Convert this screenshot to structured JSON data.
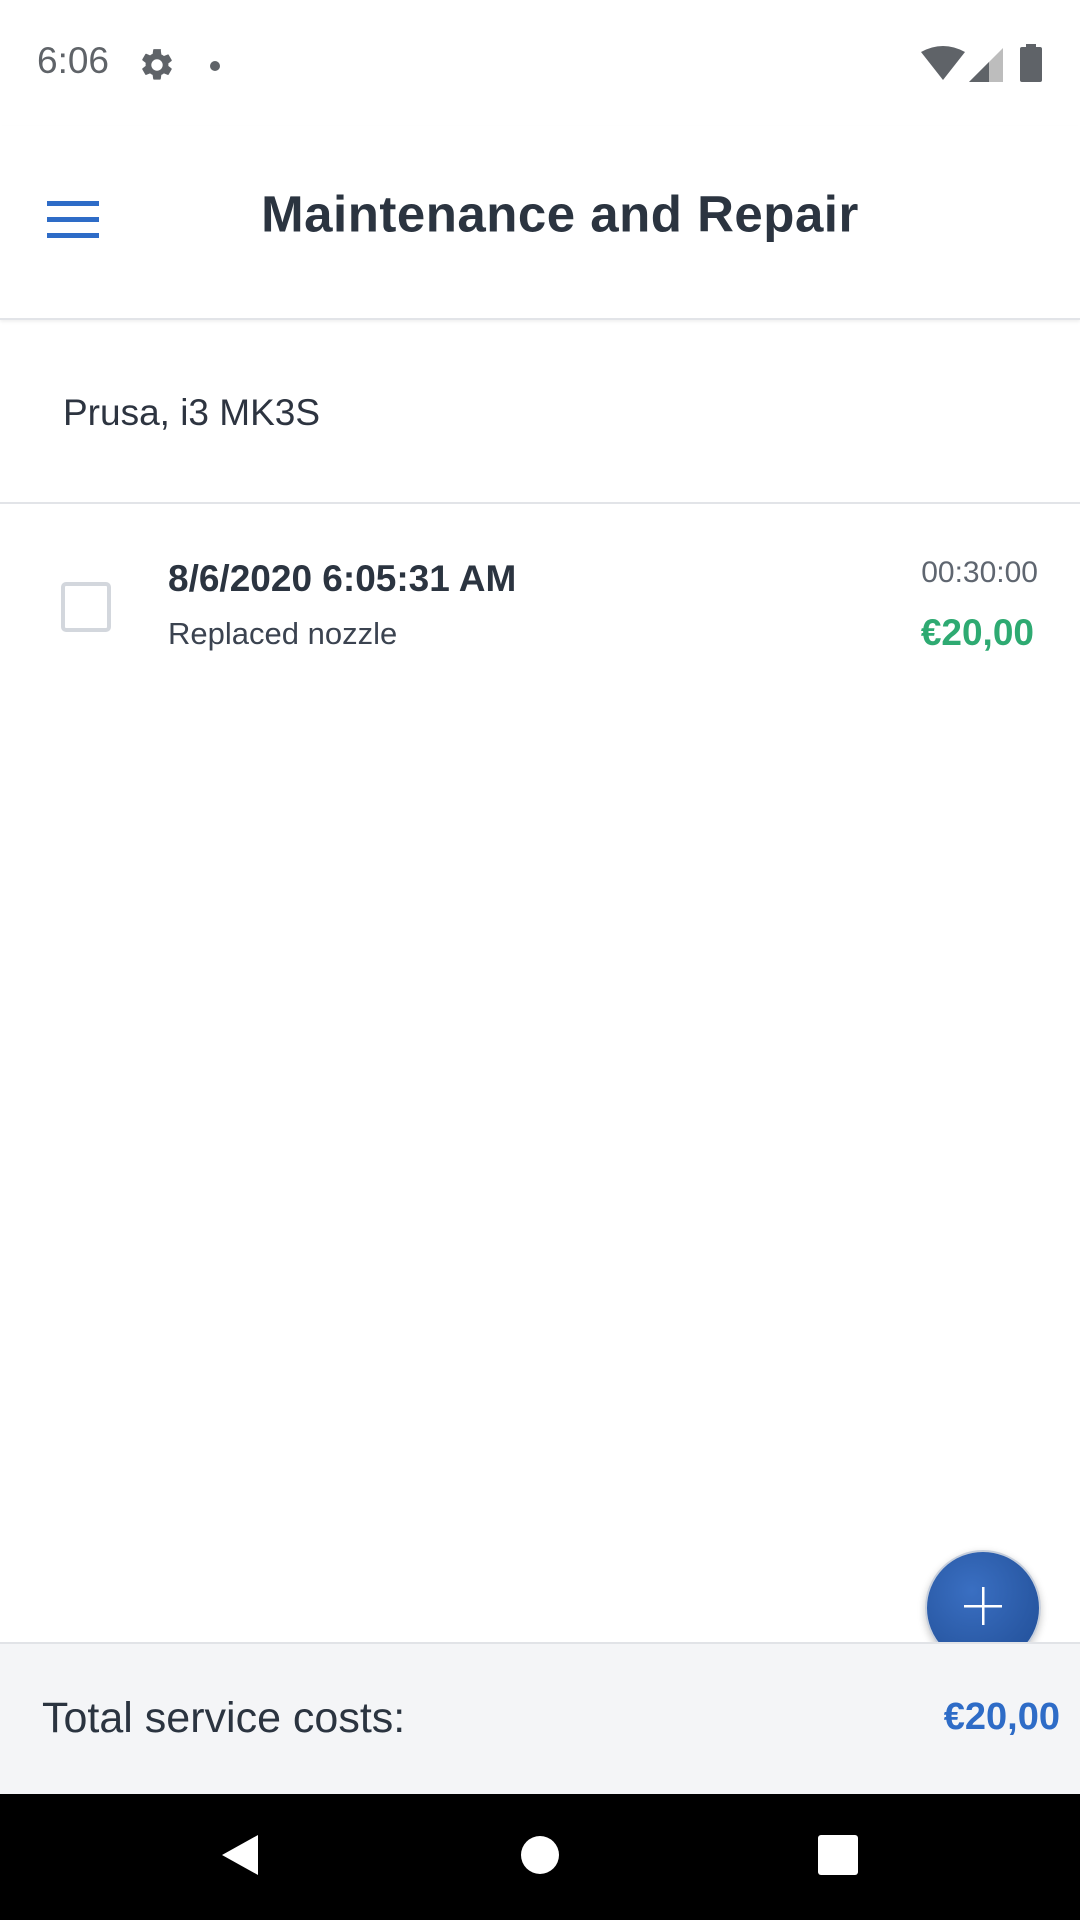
{
  "status_bar": {
    "time": "6:06",
    "icons": [
      "settings-icon",
      "notification-dot-icon",
      "wifi-icon",
      "cell-signal-icon",
      "battery-icon"
    ]
  },
  "app_bar": {
    "title": "Maintenance and Repair",
    "menu_icon": "menu-icon"
  },
  "device": {
    "name": "Prusa, i3 MK3S"
  },
  "entries": [
    {
      "date": "8/6/2020 6:05:31 AM",
      "description": "Replaced nozzle",
      "duration": "00:30:00",
      "cost": "€20,00",
      "checked": false
    }
  ],
  "fab": {
    "icon": "plus-icon"
  },
  "footer": {
    "label": "Total service costs:",
    "total": "€20,00"
  },
  "nav_bar": {
    "icons": [
      "back-icon",
      "home-icon",
      "recents-icon"
    ]
  },
  "colors": {
    "accent": "#2e6cc7",
    "cost_green": "#2eaa72",
    "fab": "#2a5aa6"
  }
}
